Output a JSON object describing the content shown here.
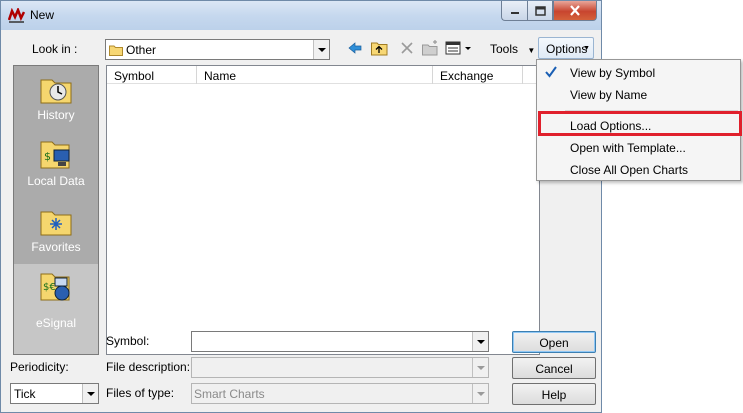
{
  "window": {
    "title": "New"
  },
  "lookin": {
    "label": "Look in :",
    "value": "Other"
  },
  "toolbar": {
    "tools_label": "Tools",
    "options_label": "Options"
  },
  "sidebar": {
    "items": [
      {
        "label": "History",
        "icon": "history-icon"
      },
      {
        "label": "Local Data",
        "icon": "local-data-icon"
      },
      {
        "label": "Favorites",
        "icon": "favorites-icon"
      },
      {
        "label": "eSignal",
        "icon": "esignal-icon"
      }
    ]
  },
  "list": {
    "columns": [
      "Symbol",
      "Name",
      "Exchange"
    ]
  },
  "form": {
    "symbol_label": "Symbol:",
    "symbol_value": "",
    "file_description_label": "File description:",
    "files_of_type_label": "Files of type:",
    "files_of_type_value": "Smart Charts",
    "periodicity_label": "Periodicity:",
    "periodicity_value": "Tick"
  },
  "buttons": {
    "open": "Open",
    "cancel": "Cancel",
    "help": "Help"
  },
  "options_menu": {
    "items": [
      "View by Symbol",
      "View by Name",
      "Load Options...",
      "Open with Template...",
      "Close All Open Charts"
    ],
    "checked": "View by Symbol"
  },
  "colors": {
    "highlight": "#e0202c",
    "check": "#1a5fb4"
  }
}
